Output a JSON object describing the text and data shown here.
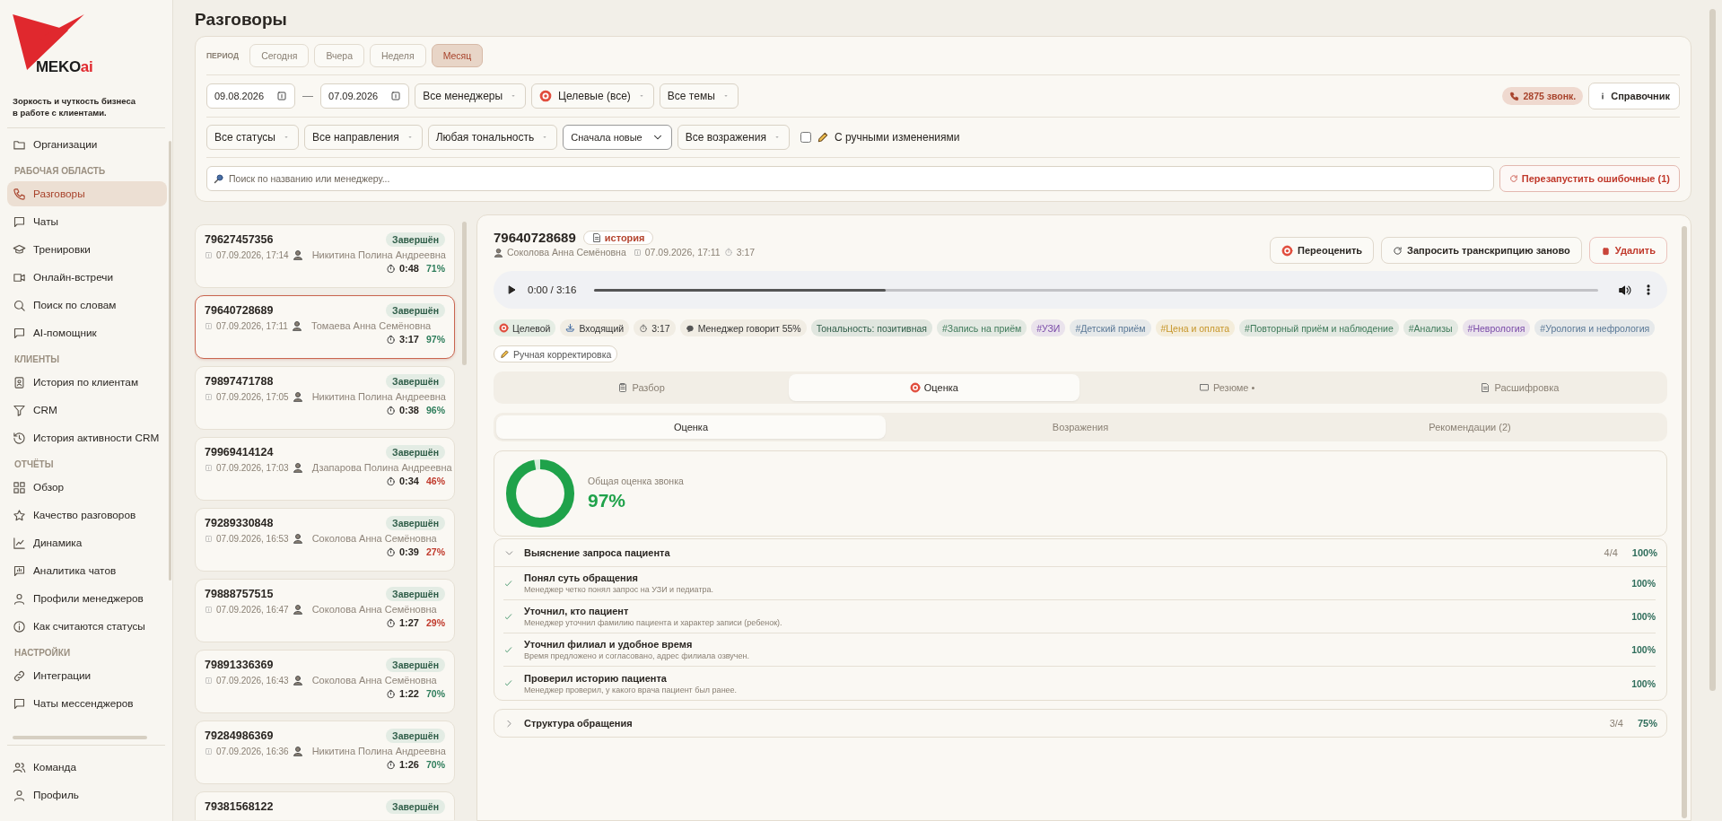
{
  "sidebar": {
    "logo": {
      "brand": "MEKO",
      "suffix": "ai"
    },
    "tagline": "Зоркость и чуткость бизнеса в работе с клиентами.",
    "top_items": [
      {
        "label": "Организации",
        "selected": false
      }
    ],
    "groups": [
      {
        "heading": "РАБОЧАЯ ОБЛАСТЬ",
        "items": [
          {
            "label": "Разговоры",
            "selected": true
          },
          {
            "label": "Чаты",
            "selected": false
          },
          {
            "label": "Тренировки",
            "selected": false
          },
          {
            "label": "Онлайн-встречи",
            "selected": false
          },
          {
            "label": "Поиск по словам",
            "selected": false
          },
          {
            "label": "AI-помощник",
            "selected": false
          }
        ]
      },
      {
        "heading": "КЛИЕНТЫ",
        "items": [
          {
            "label": "История по клиентам",
            "selected": false
          },
          {
            "label": "CRM",
            "selected": false
          },
          {
            "label": "История активности CRM",
            "selected": false
          }
        ]
      },
      {
        "heading": "ОТЧЁТЫ",
        "items": [
          {
            "label": "Обзор",
            "selected": false
          },
          {
            "label": "Качество разговоров",
            "selected": false
          },
          {
            "label": "Динамика",
            "selected": false
          },
          {
            "label": "Аналитика чатов",
            "selected": false
          },
          {
            "label": "Профили менеджеров",
            "selected": false
          },
          {
            "label": "Как считаются статусы",
            "selected": false
          }
        ]
      },
      {
        "heading": "НАСТРОЙКИ",
        "items": [
          {
            "label": "Интеграции",
            "selected": false
          },
          {
            "label": "Чаты мессенджеров",
            "selected": false
          }
        ]
      }
    ],
    "bottom_items": [
      {
        "label": "Команда",
        "selected": false
      },
      {
        "label": "Профиль",
        "selected": false
      }
    ]
  },
  "page_title": "Разговоры",
  "filters": {
    "period_label": "ПЕРИОД",
    "periods": [
      {
        "label": "Сегодня",
        "selected": false
      },
      {
        "label": "Вчера",
        "selected": false
      },
      {
        "label": "Неделя",
        "selected": false
      },
      {
        "label": "Месяц",
        "selected": true
      }
    ],
    "date_from": "09.08.2026",
    "date_separator": "—",
    "date_to": "07.09.2026",
    "row2_selects": [
      {
        "label": "Все менеджеры",
        "kind": "plain"
      },
      {
        "label": "Целевые (все)",
        "kind": "target"
      },
      {
        "label": "Все темы",
        "kind": "plain"
      }
    ],
    "calls_count": "2875 звонк.",
    "reference_button": "Справочник",
    "row3_selects": [
      {
        "label": "Все статусы",
        "kind": "plain"
      },
      {
        "label": "Все направления",
        "kind": "plain"
      },
      {
        "label": "Любая тональность",
        "kind": "plain"
      },
      {
        "label": "Сначала новые",
        "kind": "sort"
      },
      {
        "label": "Все возражения",
        "kind": "plain"
      }
    ],
    "manual_changes": {
      "label": "С ручными изменениями",
      "checked": false
    },
    "search": {
      "placeholder": "Поиск по названию или менеджеру..."
    },
    "restart_button": "Перезапустить ошибочные (1)"
  },
  "calls": [
    {
      "phone": "79627457356",
      "status": "Завершён",
      "date": "07.09.2026, 17:14",
      "manager": "Никитина Полина Андреевна",
      "duration": "0:48",
      "score": "71%",
      "color": "#2e7d5b",
      "selected": false
    },
    {
      "phone": "79640728689",
      "status": "Завершён",
      "date": "07.09.2026, 17:11",
      "manager": "Томаева Анна Семёновна",
      "duration": "3:17",
      "score": "97%",
      "color": "#2e7d5b",
      "selected": true
    },
    {
      "phone": "79897471788",
      "status": "Завершён",
      "date": "07.09.2026, 17:05",
      "manager": "Никитина Полина Андреевна",
      "duration": "0:38",
      "score": "96%",
      "color": "#2e7d5b",
      "selected": false
    },
    {
      "phone": "79969414124",
      "status": "Завершён",
      "date": "07.09.2026, 17:03",
      "manager": "Дзапарова Полина Андреевна",
      "duration": "0:34",
      "score": "46%",
      "color": "#c0392b",
      "selected": false
    },
    {
      "phone": "79289330848",
      "status": "Завершён",
      "date": "07.09.2026, 16:53",
      "manager": "Соколова Анна Семёновна",
      "duration": "0:39",
      "score": "27%",
      "color": "#c0392b",
      "selected": false
    },
    {
      "phone": "79888757515",
      "status": "Завершён",
      "date": "07.09.2026, 16:47",
      "manager": "Соколова Анна Семёновна",
      "duration": "1:27",
      "score": "29%",
      "color": "#c0392b",
      "selected": false
    },
    {
      "phone": "79891336369",
      "status": "Завершён",
      "date": "07.09.2026, 16:43",
      "manager": "Соколова Анна Семёновна",
      "duration": "1:22",
      "score": "70%",
      "color": "#2e7d5b",
      "selected": false
    },
    {
      "phone": "79284986369",
      "status": "Завершён",
      "date": "07.09.2026, 16:36",
      "manager": "Никитина Полина Андреевна",
      "duration": "1:26",
      "score": "70%",
      "color": "#2e7d5b",
      "selected": false
    },
    {
      "phone": "79381568122",
      "status": "Завершён",
      "selected": false
    }
  ],
  "detail": {
    "phone": "79640728689",
    "history_badge": "история",
    "manager": "Соколова Анна Семёновна",
    "date": "07.09.2026, 17:11",
    "duration": "3:17",
    "actions": [
      {
        "label": "Переоценить",
        "kind": "rescore"
      },
      {
        "label": "Запросить транскрипцию заново",
        "kind": "retry"
      },
      {
        "label": "Удалить",
        "kind": "delete"
      }
    ],
    "player": {
      "time": "0:00 / 3:16",
      "level": 0.29
    },
    "tags": [
      {
        "label": "Целевой",
        "kind": "target"
      },
      {
        "label": "Входящий",
        "kind": "direction"
      },
      {
        "label": "3:17",
        "kind": "duration"
      },
      {
        "label": "Менеджер говорит 55%",
        "kind": "talk"
      },
      {
        "label": "Тональность: позитивная",
        "kind": "topic",
        "color": "#2f5d48"
      },
      {
        "label": "#Запись на приём",
        "kind": "topic",
        "color": "#3f7a5a"
      },
      {
        "label": "#УЗИ",
        "kind": "topic",
        "color": "#7a4aa8"
      },
      {
        "label": "#Детский приём",
        "kind": "topic",
        "color": "#5a7896"
      },
      {
        "label": "#Цена и оплата",
        "kind": "topic",
        "color": "#c7962a"
      },
      {
        "label": "#Повторный приём и наблюдение",
        "kind": "topic",
        "color": "#3f7a5a"
      },
      {
        "label": "#Анализы",
        "kind": "topic",
        "color": "#3f7a5a"
      },
      {
        "label": "#Неврология",
        "kind": "topic",
        "color": "#7a4aa8"
      },
      {
        "label": "#Урология и нефрология",
        "kind": "topic",
        "color": "#5a7896"
      },
      {
        "label": "Ручная корректировка",
        "kind": "manual"
      }
    ],
    "tabs": [
      {
        "label": "Разбор",
        "selected": false
      },
      {
        "label": "Оценка",
        "selected": true
      },
      {
        "label": "Резюме •",
        "selected": false
      },
      {
        "label": "Расшифровка",
        "selected": false
      }
    ],
    "subtabs": [
      {
        "label": "Оценка",
        "selected": true
      },
      {
        "label": "Возражения",
        "selected": false
      },
      {
        "label": "Рекомендации (2)",
        "selected": false
      }
    ],
    "score": {
      "label": "Общая оценка звонка",
      "value": "97%",
      "level": 0.97
    },
    "sections": [
      {
        "title": "Выяснение запроса пациента",
        "count": "4/4",
        "percent": "100%",
        "expanded": true,
        "criteria": [
          {
            "title": "Понял суть обращения",
            "note": "Менеджер четко понял запрос на УЗИ и педиатра.",
            "percent": "100%",
            "passed": true
          },
          {
            "title": "Уточнил, кто пациент",
            "note": "Менеджер уточнил фамилию пациента и характер записи (ребенок).",
            "percent": "100%",
            "passed": true
          },
          {
            "title": "Уточнил филиал и удобное время",
            "note": "Время предложено и согласовано, адрес филиала озвучен.",
            "percent": "100%",
            "passed": true
          },
          {
            "title": "Проверил историю пациента",
            "note": "Менеджер проверил, у какого врача пациент был ранее.",
            "percent": "100%",
            "passed": true
          }
        ]
      },
      {
        "title": "Структура обращения",
        "count": "3/4",
        "percent": "75%",
        "expanded": false
      }
    ]
  }
}
